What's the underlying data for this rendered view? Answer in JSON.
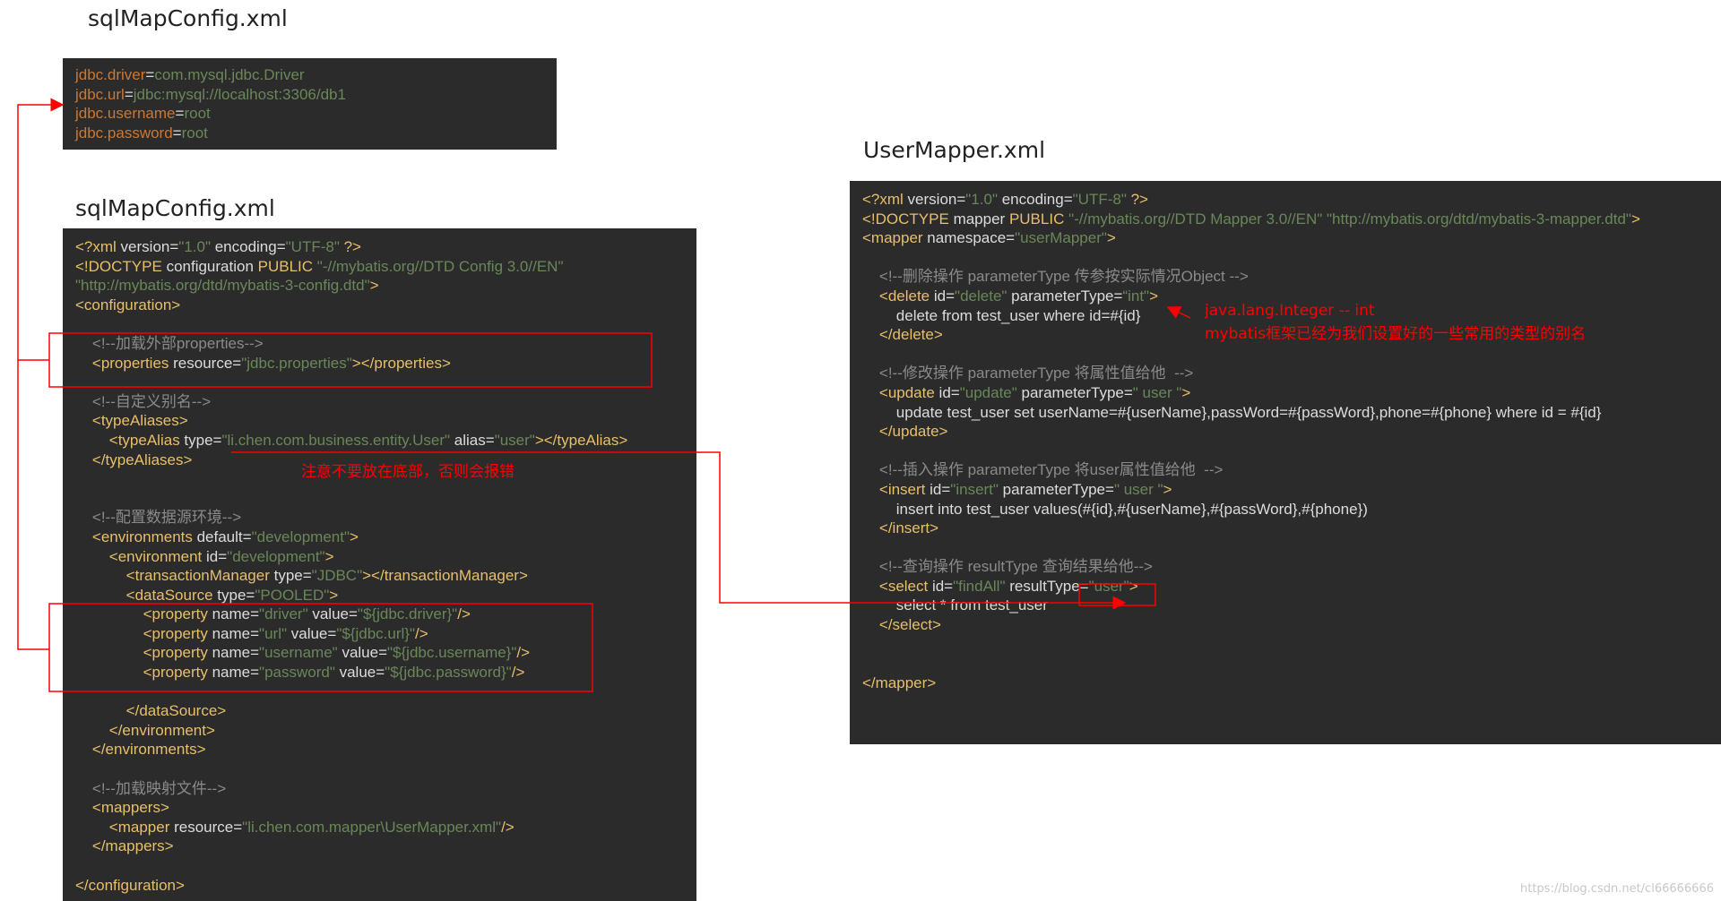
{
  "titles": {
    "top": "sqlMapConfig.xml",
    "middle": "sqlMapConfig.xml",
    "right": "UserMapper.xml"
  },
  "properties_panel": [
    [
      {
        "c": "pk",
        "t": "jdbc.driver"
      },
      {
        "c": "eq",
        "t": "="
      },
      {
        "c": "pv",
        "t": "com.mysql.jdbc.Driver"
      }
    ],
    [
      {
        "c": "pk",
        "t": "jdbc.url"
      },
      {
        "c": "eq",
        "t": "="
      },
      {
        "c": "pv",
        "t": "jdbc:mysql://localhost:3306/db1"
      }
    ],
    [
      {
        "c": "pk",
        "t": "jdbc.username"
      },
      {
        "c": "eq",
        "t": "="
      },
      {
        "c": "pv",
        "t": "root"
      }
    ],
    [
      {
        "c": "pk",
        "t": "jdbc.password"
      },
      {
        "c": "eq",
        "t": "="
      },
      {
        "c": "pv",
        "t": "root"
      }
    ]
  ],
  "config_panel": [
    [
      {
        "c": "tg",
        "t": "<?xml "
      },
      {
        "c": "at",
        "t": "version="
      },
      {
        "c": "vl",
        "t": "\"1.0\""
      },
      {
        "c": "at",
        "t": " encoding="
      },
      {
        "c": "vl",
        "t": "\"UTF-8\""
      },
      {
        "c": "tg",
        "t": " ?>"
      }
    ],
    [
      {
        "c": "tg",
        "t": "<!DOCTYPE "
      },
      {
        "c": "at",
        "t": "configuration "
      },
      {
        "c": "tg",
        "t": "PUBLIC "
      },
      {
        "c": "vl",
        "t": "\"-//mybatis.org//DTD Config 3.0//EN\""
      }
    ],
    [
      {
        "c": "vl",
        "t": "\"http://mybatis.org/dtd/mybatis-3-config.dtd\""
      },
      {
        "c": "tg",
        "t": ">"
      }
    ],
    [
      {
        "c": "tg",
        "t": "<configuration>"
      }
    ],
    [],
    [
      {
        "c": "cm",
        "t": "    <!--加载外部properties-->"
      }
    ],
    [
      {
        "c": "tg",
        "t": "    <properties "
      },
      {
        "c": "at",
        "t": "resource="
      },
      {
        "c": "vl",
        "t": "\"jdbc.properties\""
      },
      {
        "c": "tg",
        "t": "></properties>"
      }
    ],
    [],
    [
      {
        "c": "cm",
        "t": "    <!--自定义别名-->"
      }
    ],
    [
      {
        "c": "tg",
        "t": "    <typeAliases>"
      }
    ],
    [
      {
        "c": "tg",
        "t": "        <typeAlias "
      },
      {
        "c": "at",
        "t": "type="
      },
      {
        "c": "vl",
        "t": "\"li.chen.com.business.entity.User\""
      },
      {
        "c": "at",
        "t": " alias="
      },
      {
        "c": "vl",
        "t": "\"user\""
      },
      {
        "c": "tg",
        "t": "></typeAlias>"
      }
    ],
    [
      {
        "c": "tg",
        "t": "    </typeAliases>"
      }
    ],
    [],
    [],
    [
      {
        "c": "cm",
        "t": "    <!--配置数据源环境-->"
      }
    ],
    [
      {
        "c": "tg",
        "t": "    <environments "
      },
      {
        "c": "at",
        "t": "default="
      },
      {
        "c": "vl",
        "t": "\"development\""
      },
      {
        "c": "tg",
        "t": ">"
      }
    ],
    [
      {
        "c": "tg",
        "t": "        <environment "
      },
      {
        "c": "at",
        "t": "id="
      },
      {
        "c": "vl",
        "t": "\"development\""
      },
      {
        "c": "tg",
        "t": ">"
      }
    ],
    [
      {
        "c": "tg",
        "t": "            <transactionManager "
      },
      {
        "c": "at",
        "t": "type="
      },
      {
        "c": "vl",
        "t": "\"JDBC\""
      },
      {
        "c": "tg",
        "t": "></transactionManager>"
      }
    ],
    [
      {
        "c": "tg",
        "t": "            <dataSource "
      },
      {
        "c": "at",
        "t": "type="
      },
      {
        "c": "vl",
        "t": "\"POOLED\""
      },
      {
        "c": "tg",
        "t": ">"
      }
    ],
    [
      {
        "c": "tg",
        "t": "                <property "
      },
      {
        "c": "at",
        "t": "name="
      },
      {
        "c": "vl",
        "t": "\"driver\""
      },
      {
        "c": "at",
        "t": " value="
      },
      {
        "c": "vl",
        "t": "\"${jdbc.driver}\""
      },
      {
        "c": "tg",
        "t": "/>"
      }
    ],
    [
      {
        "c": "tg",
        "t": "                <property "
      },
      {
        "c": "at",
        "t": "name="
      },
      {
        "c": "vl",
        "t": "\"url\""
      },
      {
        "c": "at",
        "t": " value="
      },
      {
        "c": "vl",
        "t": "\"${jdbc.url}\""
      },
      {
        "c": "tg",
        "t": "/>"
      }
    ],
    [
      {
        "c": "tg",
        "t": "                <property "
      },
      {
        "c": "at",
        "t": "name="
      },
      {
        "c": "vl",
        "t": "\"username\""
      },
      {
        "c": "at",
        "t": " value="
      },
      {
        "c": "vl",
        "t": "\"${jdbc.username}\""
      },
      {
        "c": "tg",
        "t": "/>"
      }
    ],
    [
      {
        "c": "tg",
        "t": "                <property "
      },
      {
        "c": "at",
        "t": "name="
      },
      {
        "c": "vl",
        "t": "\"password\""
      },
      {
        "c": "at",
        "t": " value="
      },
      {
        "c": "vl",
        "t": "\"${jdbc.password}\""
      },
      {
        "c": "tg",
        "t": "/>"
      }
    ],
    [],
    [
      {
        "c": "tg",
        "t": "            </dataSource>"
      }
    ],
    [
      {
        "c": "tg",
        "t": "        </environment>"
      }
    ],
    [
      {
        "c": "tg",
        "t": "    </environments>"
      }
    ],
    [],
    [
      {
        "c": "cm",
        "t": "    <!--加载映射文件-->"
      }
    ],
    [
      {
        "c": "tg",
        "t": "    <mappers>"
      }
    ],
    [
      {
        "c": "tg",
        "t": "        <mapper "
      },
      {
        "c": "at",
        "t": "resource="
      },
      {
        "c": "vl",
        "t": "\"li.chen.com.mapper\\UserMapper.xml\""
      },
      {
        "c": "tg",
        "t": "/>"
      }
    ],
    [
      {
        "c": "tg",
        "t": "    </mappers>"
      }
    ],
    [],
    [
      {
        "c": "tg",
        "t": "</configuration>"
      }
    ]
  ],
  "mapper_panel": [
    [
      {
        "c": "tg",
        "t": "<?xml "
      },
      {
        "c": "at",
        "t": "version="
      },
      {
        "c": "vl",
        "t": "\"1.0\""
      },
      {
        "c": "at",
        "t": " encoding="
      },
      {
        "c": "vl",
        "t": "\"UTF-8\""
      },
      {
        "c": "tg",
        "t": " ?>"
      }
    ],
    [
      {
        "c": "tg",
        "t": "<!DOCTYPE "
      },
      {
        "c": "at",
        "t": "mapper "
      },
      {
        "c": "tg",
        "t": "PUBLIC "
      },
      {
        "c": "vl",
        "t": "\"-//mybatis.org//DTD Mapper 3.0//EN\""
      },
      {
        "c": "vl",
        "t": " \"http://mybatis.org/dtd/mybatis-3-mapper.dtd\""
      },
      {
        "c": "tg",
        "t": ">"
      }
    ],
    [
      {
        "c": "tg",
        "t": "<mapper "
      },
      {
        "c": "at",
        "t": "namespace="
      },
      {
        "c": "vl",
        "t": "\"userMapper\""
      },
      {
        "c": "tg",
        "t": ">"
      }
    ],
    [],
    [
      {
        "c": "cm",
        "t": "    <!--删除操作 parameterType 传参按实际情况Object -->"
      }
    ],
    [
      {
        "c": "tg",
        "t": "    <delete "
      },
      {
        "c": "at",
        "t": "id="
      },
      {
        "c": "vl",
        "t": "\"delete\""
      },
      {
        "c": "at",
        "t": " parameterType="
      },
      {
        "c": "vl",
        "t": "“int\""
      },
      {
        "c": "tg",
        "t": ">"
      }
    ],
    [
      {
        "c": "pl",
        "t": "        delete from test_user where id=#{id}"
      }
    ],
    [
      {
        "c": "tg",
        "t": "    </delete>"
      }
    ],
    [],
    [
      {
        "c": "cm",
        "t": "    <!--修改操作 parameterType 将属性值给他  -->"
      }
    ],
    [
      {
        "c": "tg",
        "t": "    <update "
      },
      {
        "c": "at",
        "t": "id="
      },
      {
        "c": "vl",
        "t": "\"update\""
      },
      {
        "c": "at",
        "t": " parameterType="
      },
      {
        "c": "vl",
        "t": "\" user \""
      },
      {
        "c": "tg",
        "t": ">"
      }
    ],
    [
      {
        "c": "pl",
        "t": "        update test_user set userName=#{userName},passWord=#{passWord},phone=#{phone} where id = #{id}"
      }
    ],
    [
      {
        "c": "tg",
        "t": "    </update>"
      }
    ],
    [],
    [
      {
        "c": "cm",
        "t": "    <!--插入操作 parameterType 将user属性值给他  -->"
      }
    ],
    [
      {
        "c": "tg",
        "t": "    <insert "
      },
      {
        "c": "at",
        "t": "id="
      },
      {
        "c": "vl",
        "t": "\"insert\""
      },
      {
        "c": "at",
        "t": " parameterType="
      },
      {
        "c": "vl",
        "t": "\" user \""
      },
      {
        "c": "tg",
        "t": ">"
      }
    ],
    [
      {
        "c": "pl",
        "t": "        insert into test_user values(#{id},#{userName},#{passWord},#{phone})"
      }
    ],
    [
      {
        "c": "tg",
        "t": "    </insert>"
      }
    ],
    [],
    [
      {
        "c": "cm",
        "t": "    <!--查询操作 resultType 查询结果给他-->"
      }
    ],
    [
      {
        "c": "tg",
        "t": "    <select "
      },
      {
        "c": "at",
        "t": "id="
      },
      {
        "c": "vl",
        "t": "\"findAll\""
      },
      {
        "c": "at",
        "t": " resultType="
      },
      {
        "c": "vl",
        "t": "\"user\""
      },
      {
        "c": "tg",
        "t": ">"
      }
    ],
    [
      {
        "c": "pl",
        "t": "        select * from test_user"
      }
    ],
    [
      {
        "c": "tg",
        "t": "    </select>"
      }
    ],
    [],
    [],
    [
      {
        "c": "tg",
        "t": "</mapper>"
      }
    ]
  ],
  "notes": {
    "alias_warning": "注意不要放在底部，否则会报错",
    "int_alias_1": "java.lang.Integer -- int",
    "int_alias_2": "mybatis框架已经为我们设置好的一些常用的类型的别名"
  },
  "watermark": "https://blog.csdn.net/cl66666666"
}
